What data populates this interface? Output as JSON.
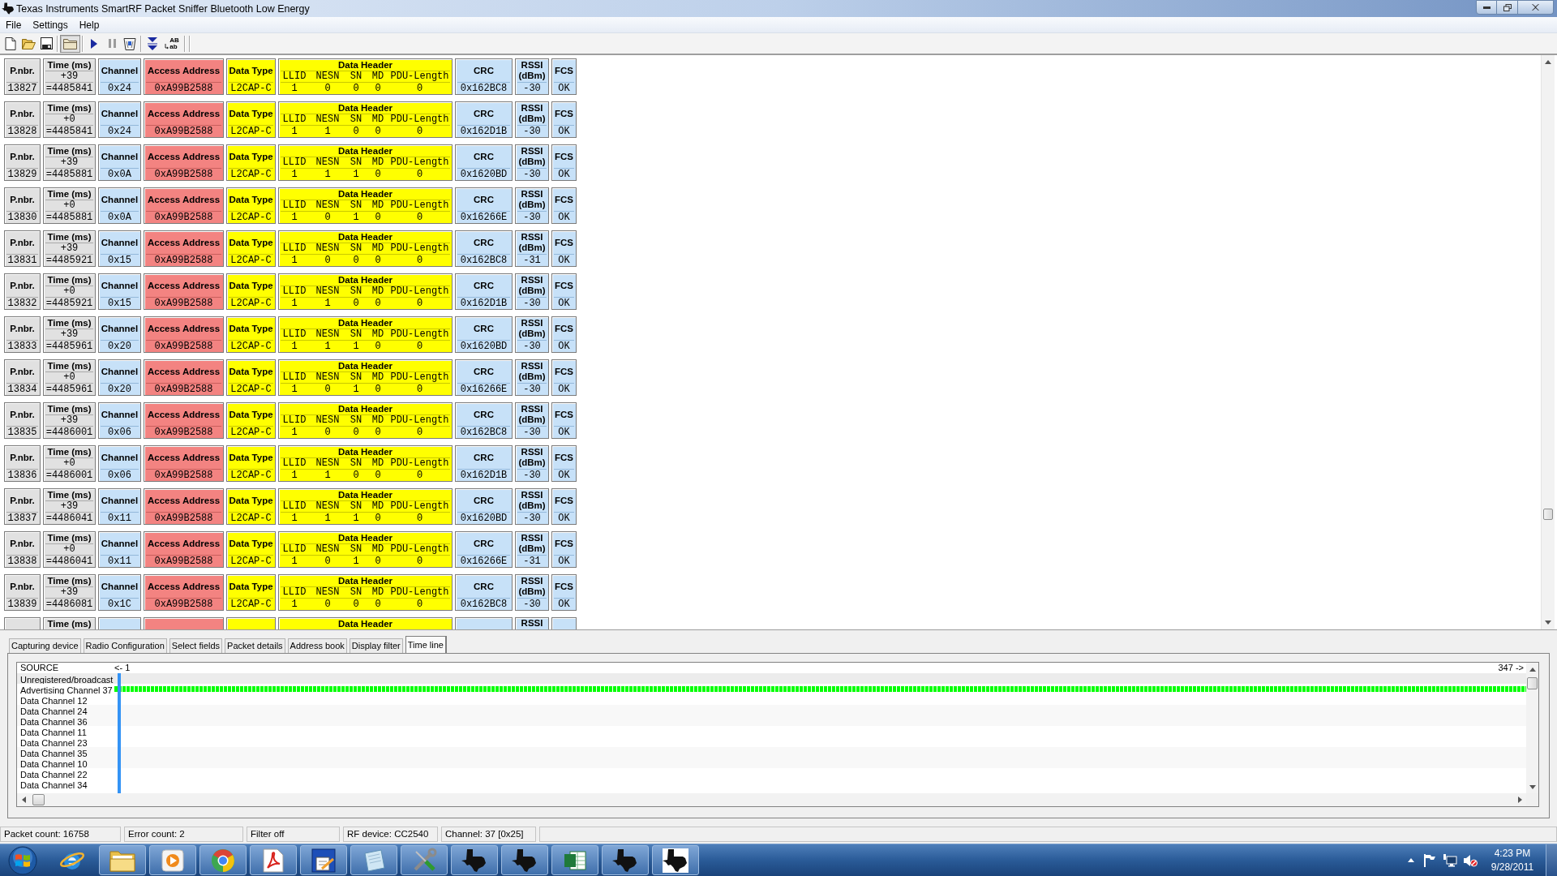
{
  "window": {
    "title": "Texas Instruments SmartRF Packet Sniffer Bluetooth Low Energy"
  },
  "menu": [
    "File",
    "Settings",
    "Help"
  ],
  "toolbar": [
    {
      "pressed": false,
      "disabled": false
    },
    {
      "pressed": false,
      "disabled": false
    },
    {
      "pressed": false,
      "disabled": false
    },
    {
      "pressed": true,
      "disabled": false
    },
    {
      "pressed": false,
      "disabled": false
    },
    {
      "pressed": false,
      "disabled": true
    },
    {
      "pressed": false,
      "disabled": false
    },
    {
      "pressed": false,
      "disabled": false
    },
    {
      "pressed": false,
      "disabled": false,
      "glyph": "AB",
      "glyph_sub": "ab"
    }
  ],
  "packets": [
    {
      "cells": [
        {
          "kind": "number",
          "label": "P.nbr.",
          "value": "13827"
        },
        {
          "kind": "time",
          "label": "Time (ms)",
          "delta": "+39",
          "value": "=4485841"
        },
        {
          "kind": "channel",
          "label": "Channel",
          "value": "0x24"
        },
        {
          "kind": "address",
          "label": "Access Address",
          "value": "0xA99B2588"
        },
        {
          "kind": "type",
          "label": "Data Type",
          "value": "L2CAP-C"
        },
        {
          "kind": "header",
          "label": "Data Header",
          "fields": [
            {
              "label": "LLID",
              "value": "1"
            },
            {
              "label": "NESN",
              "value": "0"
            },
            {
              "label": "SN",
              "value": "0"
            },
            {
              "label": "MD",
              "value": "0"
            },
            {
              "label": "PDU-Length",
              "value": "0"
            }
          ]
        },
        {
          "kind": "crc",
          "label": "CRC",
          "value": "0x162BC8"
        },
        {
          "kind": "rssi",
          "label": "RSSI",
          "unit": "(dBm)",
          "value": "-30"
        },
        {
          "kind": "fcs",
          "label": "FCS",
          "value": "OK"
        }
      ]
    },
    {
      "cells": [
        {
          "kind": "number",
          "label": "P.nbr.",
          "value": "13828"
        },
        {
          "kind": "time",
          "label": "Time (ms)",
          "delta": "+0",
          "value": "=4485841"
        },
        {
          "kind": "channel",
          "label": "Channel",
          "value": "0x24"
        },
        {
          "kind": "address",
          "label": "Access Address",
          "value": "0xA99B2588"
        },
        {
          "kind": "type",
          "label": "Data Type",
          "value": "L2CAP-C"
        },
        {
          "kind": "header",
          "label": "Data Header",
          "fields": [
            {
              "label": "LLID",
              "value": "1"
            },
            {
              "label": "NESN",
              "value": "1"
            },
            {
              "label": "SN",
              "value": "0"
            },
            {
              "label": "MD",
              "value": "0"
            },
            {
              "label": "PDU-Length",
              "value": "0"
            }
          ]
        },
        {
          "kind": "crc",
          "label": "CRC",
          "value": "0x162D1B"
        },
        {
          "kind": "rssi",
          "label": "RSSI",
          "unit": "(dBm)",
          "value": "-30"
        },
        {
          "kind": "fcs",
          "label": "FCS",
          "value": "OK"
        }
      ]
    },
    {
      "cells": [
        {
          "kind": "number",
          "label": "P.nbr.",
          "value": "13829"
        },
        {
          "kind": "time",
          "label": "Time (ms)",
          "delta": "+39",
          "value": "=4485881"
        },
        {
          "kind": "channel",
          "label": "Channel",
          "value": "0x0A"
        },
        {
          "kind": "address",
          "label": "Access Address",
          "value": "0xA99B2588"
        },
        {
          "kind": "type",
          "label": "Data Type",
          "value": "L2CAP-C"
        },
        {
          "kind": "header",
          "label": "Data Header",
          "fields": [
            {
              "label": "LLID",
              "value": "1"
            },
            {
              "label": "NESN",
              "value": "1"
            },
            {
              "label": "SN",
              "value": "1"
            },
            {
              "label": "MD",
              "value": "0"
            },
            {
              "label": "PDU-Length",
              "value": "0"
            }
          ]
        },
        {
          "kind": "crc",
          "label": "CRC",
          "value": "0x1620BD"
        },
        {
          "kind": "rssi",
          "label": "RSSI",
          "unit": "(dBm)",
          "value": "-30"
        },
        {
          "kind": "fcs",
          "label": "FCS",
          "value": "OK"
        }
      ]
    },
    {
      "cells": [
        {
          "kind": "number",
          "label": "P.nbr.",
          "value": "13830"
        },
        {
          "kind": "time",
          "label": "Time (ms)",
          "delta": "+0",
          "value": "=4485881"
        },
        {
          "kind": "channel",
          "label": "Channel",
          "value": "0x0A"
        },
        {
          "kind": "address",
          "label": "Access Address",
          "value": "0xA99B2588"
        },
        {
          "kind": "type",
          "label": "Data Type",
          "value": "L2CAP-C"
        },
        {
          "kind": "header",
          "label": "Data Header",
          "fields": [
            {
              "label": "LLID",
              "value": "1"
            },
            {
              "label": "NESN",
              "value": "0"
            },
            {
              "label": "SN",
              "value": "1"
            },
            {
              "label": "MD",
              "value": "0"
            },
            {
              "label": "PDU-Length",
              "value": "0"
            }
          ]
        },
        {
          "kind": "crc",
          "label": "CRC",
          "value": "0x16266E"
        },
        {
          "kind": "rssi",
          "label": "RSSI",
          "unit": "(dBm)",
          "value": "-30"
        },
        {
          "kind": "fcs",
          "label": "FCS",
          "value": "OK"
        }
      ]
    },
    {
      "cells": [
        {
          "kind": "number",
          "label": "P.nbr.",
          "value": "13831"
        },
        {
          "kind": "time",
          "label": "Time (ms)",
          "delta": "+39",
          "value": "=4485921"
        },
        {
          "kind": "channel",
          "label": "Channel",
          "value": "0x15"
        },
        {
          "kind": "address",
          "label": "Access Address",
          "value": "0xA99B2588"
        },
        {
          "kind": "type",
          "label": "Data Type",
          "value": "L2CAP-C"
        },
        {
          "kind": "header",
          "label": "Data Header",
          "fields": [
            {
              "label": "LLID",
              "value": "1"
            },
            {
              "label": "NESN",
              "value": "0"
            },
            {
              "label": "SN",
              "value": "0"
            },
            {
              "label": "MD",
              "value": "0"
            },
            {
              "label": "PDU-Length",
              "value": "0"
            }
          ]
        },
        {
          "kind": "crc",
          "label": "CRC",
          "value": "0x162BC8"
        },
        {
          "kind": "rssi",
          "label": "RSSI",
          "unit": "(dBm)",
          "value": "-31"
        },
        {
          "kind": "fcs",
          "label": "FCS",
          "value": "OK"
        }
      ]
    },
    {
      "cells": [
        {
          "kind": "number",
          "label": "P.nbr.",
          "value": "13832"
        },
        {
          "kind": "time",
          "label": "Time (ms)",
          "delta": "+0",
          "value": "=4485921"
        },
        {
          "kind": "channel",
          "label": "Channel",
          "value": "0x15"
        },
        {
          "kind": "address",
          "label": "Access Address",
          "value": "0xA99B2588"
        },
        {
          "kind": "type",
          "label": "Data Type",
          "value": "L2CAP-C"
        },
        {
          "kind": "header",
          "label": "Data Header",
          "fields": [
            {
              "label": "LLID",
              "value": "1"
            },
            {
              "label": "NESN",
              "value": "1"
            },
            {
              "label": "SN",
              "value": "0"
            },
            {
              "label": "MD",
              "value": "0"
            },
            {
              "label": "PDU-Length",
              "value": "0"
            }
          ]
        },
        {
          "kind": "crc",
          "label": "CRC",
          "value": "0x162D1B"
        },
        {
          "kind": "rssi",
          "label": "RSSI",
          "unit": "(dBm)",
          "value": "-30"
        },
        {
          "kind": "fcs",
          "label": "FCS",
          "value": "OK"
        }
      ]
    },
    {
      "cells": [
        {
          "kind": "number",
          "label": "P.nbr.",
          "value": "13833"
        },
        {
          "kind": "time",
          "label": "Time (ms)",
          "delta": "+39",
          "value": "=4485961"
        },
        {
          "kind": "channel",
          "label": "Channel",
          "value": "0x20"
        },
        {
          "kind": "address",
          "label": "Access Address",
          "value": "0xA99B2588"
        },
        {
          "kind": "type",
          "label": "Data Type",
          "value": "L2CAP-C"
        },
        {
          "kind": "header",
          "label": "Data Header",
          "fields": [
            {
              "label": "LLID",
              "value": "1"
            },
            {
              "label": "NESN",
              "value": "1"
            },
            {
              "label": "SN",
              "value": "1"
            },
            {
              "label": "MD",
              "value": "0"
            },
            {
              "label": "PDU-Length",
              "value": "0"
            }
          ]
        },
        {
          "kind": "crc",
          "label": "CRC",
          "value": "0x1620BD"
        },
        {
          "kind": "rssi",
          "label": "RSSI",
          "unit": "(dBm)",
          "value": "-30"
        },
        {
          "kind": "fcs",
          "label": "FCS",
          "value": "OK"
        }
      ]
    },
    {
      "cells": [
        {
          "kind": "number",
          "label": "P.nbr.",
          "value": "13834"
        },
        {
          "kind": "time",
          "label": "Time (ms)",
          "delta": "+0",
          "value": "=4485961"
        },
        {
          "kind": "channel",
          "label": "Channel",
          "value": "0x20"
        },
        {
          "kind": "address",
          "label": "Access Address",
          "value": "0xA99B2588"
        },
        {
          "kind": "type",
          "label": "Data Type",
          "value": "L2CAP-C"
        },
        {
          "kind": "header",
          "label": "Data Header",
          "fields": [
            {
              "label": "LLID",
              "value": "1"
            },
            {
              "label": "NESN",
              "value": "0"
            },
            {
              "label": "SN",
              "value": "1"
            },
            {
              "label": "MD",
              "value": "0"
            },
            {
              "label": "PDU-Length",
              "value": "0"
            }
          ]
        },
        {
          "kind": "crc",
          "label": "CRC",
          "value": "0x16266E"
        },
        {
          "kind": "rssi",
          "label": "RSSI",
          "unit": "(dBm)",
          "value": "-30"
        },
        {
          "kind": "fcs",
          "label": "FCS",
          "value": "OK"
        }
      ]
    },
    {
      "cells": [
        {
          "kind": "number",
          "label": "P.nbr.",
          "value": "13835"
        },
        {
          "kind": "time",
          "label": "Time (ms)",
          "delta": "+39",
          "value": "=4486001"
        },
        {
          "kind": "channel",
          "label": "Channel",
          "value": "0x06"
        },
        {
          "kind": "address",
          "label": "Access Address",
          "value": "0xA99B2588"
        },
        {
          "kind": "type",
          "label": "Data Type",
          "value": "L2CAP-C"
        },
        {
          "kind": "header",
          "label": "Data Header",
          "fields": [
            {
              "label": "LLID",
              "value": "1"
            },
            {
              "label": "NESN",
              "value": "0"
            },
            {
              "label": "SN",
              "value": "0"
            },
            {
              "label": "MD",
              "value": "0"
            },
            {
              "label": "PDU-Length",
              "value": "0"
            }
          ]
        },
        {
          "kind": "crc",
          "label": "CRC",
          "value": "0x162BC8"
        },
        {
          "kind": "rssi",
          "label": "RSSI",
          "unit": "(dBm)",
          "value": "-30"
        },
        {
          "kind": "fcs",
          "label": "FCS",
          "value": "OK"
        }
      ]
    },
    {
      "cells": [
        {
          "kind": "number",
          "label": "P.nbr.",
          "value": "13836"
        },
        {
          "kind": "time",
          "label": "Time (ms)",
          "delta": "+0",
          "value": "=4486001"
        },
        {
          "kind": "channel",
          "label": "Channel",
          "value": "0x06"
        },
        {
          "kind": "address",
          "label": "Access Address",
          "value": "0xA99B2588"
        },
        {
          "kind": "type",
          "label": "Data Type",
          "value": "L2CAP-C"
        },
        {
          "kind": "header",
          "label": "Data Header",
          "fields": [
            {
              "label": "LLID",
              "value": "1"
            },
            {
              "label": "NESN",
              "value": "1"
            },
            {
              "label": "SN",
              "value": "0"
            },
            {
              "label": "MD",
              "value": "0"
            },
            {
              "label": "PDU-Length",
              "value": "0"
            }
          ]
        },
        {
          "kind": "crc",
          "label": "CRC",
          "value": "0x162D1B"
        },
        {
          "kind": "rssi",
          "label": "RSSI",
          "unit": "(dBm)",
          "value": "-30"
        },
        {
          "kind": "fcs",
          "label": "FCS",
          "value": "OK"
        }
      ]
    },
    {
      "cells": [
        {
          "kind": "number",
          "label": "P.nbr.",
          "value": "13837"
        },
        {
          "kind": "time",
          "label": "Time (ms)",
          "delta": "+39",
          "value": "=4486041"
        },
        {
          "kind": "channel",
          "label": "Channel",
          "value": "0x11"
        },
        {
          "kind": "address",
          "label": "Access Address",
          "value": "0xA99B2588"
        },
        {
          "kind": "type",
          "label": "Data Type",
          "value": "L2CAP-C"
        },
        {
          "kind": "header",
          "label": "Data Header",
          "fields": [
            {
              "label": "LLID",
              "value": "1"
            },
            {
              "label": "NESN",
              "value": "1"
            },
            {
              "label": "SN",
              "value": "1"
            },
            {
              "label": "MD",
              "value": "0"
            },
            {
              "label": "PDU-Length",
              "value": "0"
            }
          ]
        },
        {
          "kind": "crc",
          "label": "CRC",
          "value": "0x1620BD"
        },
        {
          "kind": "rssi",
          "label": "RSSI",
          "unit": "(dBm)",
          "value": "-30"
        },
        {
          "kind": "fcs",
          "label": "FCS",
          "value": "OK"
        }
      ]
    },
    {
      "cells": [
        {
          "kind": "number",
          "label": "P.nbr.",
          "value": "13838"
        },
        {
          "kind": "time",
          "label": "Time (ms)",
          "delta": "+0",
          "value": "=4486041"
        },
        {
          "kind": "channel",
          "label": "Channel",
          "value": "0x11"
        },
        {
          "kind": "address",
          "label": "Access Address",
          "value": "0xA99B2588"
        },
        {
          "kind": "type",
          "label": "Data Type",
          "value": "L2CAP-C"
        },
        {
          "kind": "header",
          "label": "Data Header",
          "fields": [
            {
              "label": "LLID",
              "value": "1"
            },
            {
              "label": "NESN",
              "value": "0"
            },
            {
              "label": "SN",
              "value": "1"
            },
            {
              "label": "MD",
              "value": "0"
            },
            {
              "label": "PDU-Length",
              "value": "0"
            }
          ]
        },
        {
          "kind": "crc",
          "label": "CRC",
          "value": "0x16266E"
        },
        {
          "kind": "rssi",
          "label": "RSSI",
          "unit": "(dBm)",
          "value": "-31"
        },
        {
          "kind": "fcs",
          "label": "FCS",
          "value": "OK"
        }
      ]
    },
    {
      "cells": [
        {
          "kind": "number",
          "label": "P.nbr.",
          "value": "13839"
        },
        {
          "kind": "time",
          "label": "Time (ms)",
          "delta": "+39",
          "value": "=4486081"
        },
        {
          "kind": "channel",
          "label": "Channel",
          "value": "0x1C"
        },
        {
          "kind": "address",
          "label": "Access Address",
          "value": "0xA99B2588"
        },
        {
          "kind": "type",
          "label": "Data Type",
          "value": "L2CAP-C"
        },
        {
          "kind": "header",
          "label": "Data Header",
          "fields": [
            {
              "label": "LLID",
              "value": "1"
            },
            {
              "label": "NESN",
              "value": "0"
            },
            {
              "label": "SN",
              "value": "0"
            },
            {
              "label": "MD",
              "value": "0"
            },
            {
              "label": "PDU-Length",
              "value": "0"
            }
          ]
        },
        {
          "kind": "crc",
          "label": "CRC",
          "value": "0x162BC8"
        },
        {
          "kind": "rssi",
          "label": "RSSI",
          "unit": "(dBm)",
          "value": "-30"
        },
        {
          "kind": "fcs",
          "label": "FCS",
          "value": "OK"
        }
      ]
    },
    {
      "cells": [
        {
          "kind": "number"
        },
        {
          "kind": "time",
          "label": "Time (ms)"
        },
        {
          "kind": "channel"
        },
        {
          "kind": "address"
        },
        {
          "kind": "type"
        },
        {
          "kind": "header",
          "label": "Data Header"
        },
        {
          "kind": "crc"
        },
        {
          "kind": "rssi",
          "label": "RSSI"
        },
        {
          "kind": "fcs"
        }
      ]
    }
  ],
  "tabs": [
    {
      "label": "Capturing device",
      "selected": false
    },
    {
      "label": "Radio Configuration",
      "selected": false
    },
    {
      "label": "Select fields",
      "selected": false
    },
    {
      "label": "Packet details",
      "selected": false
    },
    {
      "label": "Address book",
      "selected": false
    },
    {
      "label": "Display filter",
      "selected": false
    },
    {
      "label": "Time line",
      "selected": true
    }
  ],
  "timeline": {
    "header": "SOURCE",
    "start": "<- 1",
    "end": "347 ->",
    "rows": [
      {
        "label": "Unregistered/broadcast",
        "active": false
      },
      {
        "label": "Advertising Channel 37",
        "active": true
      },
      {
        "label": "Data Channel 12",
        "active": false
      },
      {
        "label": "Data Channel 24",
        "active": false
      },
      {
        "label": "Data Channel 36",
        "active": false
      },
      {
        "label": "Data Channel 11",
        "active": false
      },
      {
        "label": "Data Channel 23",
        "active": false
      },
      {
        "label": "Data Channel 35",
        "active": false
      },
      {
        "label": "Data Channel 10",
        "active": false
      },
      {
        "label": "Data Channel 22",
        "active": false
      },
      {
        "label": "Data Channel 34",
        "active": false
      }
    ]
  },
  "status_bar": [
    "Packet count: 16758",
    "Error count: 2",
    "Filter off",
    "RF device: CC2540",
    "Channel: 37 [0x25]"
  ],
  "taskbar": {
    "apps": [
      {
        "running": false
      },
      {
        "running": true
      },
      {
        "running": true
      },
      {
        "running": true
      },
      {
        "running": true
      },
      {
        "running": true
      },
      {
        "running": true
      },
      {
        "running": true
      },
      {
        "running": true
      },
      {
        "running": true
      },
      {
        "running": true
      },
      {
        "running": true
      },
      {
        "running": true
      }
    ],
    "clock": {
      "time": "4:23 PM",
      "date": "9/28/2011"
    }
  }
}
